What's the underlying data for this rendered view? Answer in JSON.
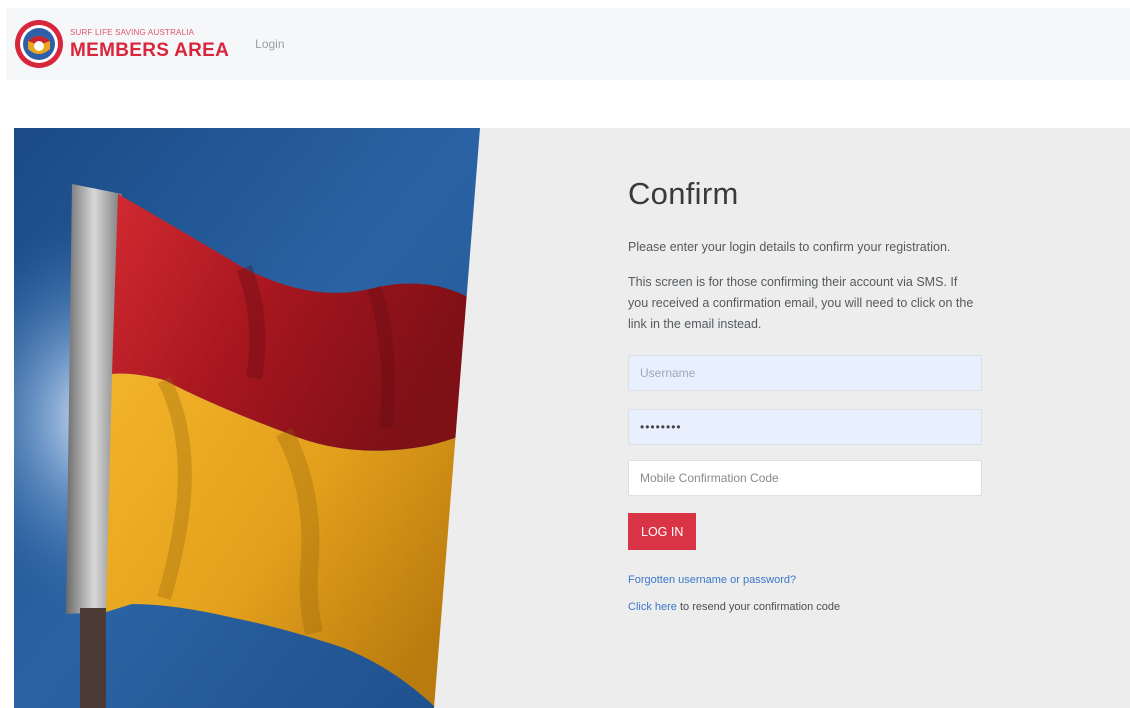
{
  "navbar": {
    "brand_small": "SURF LIFE SAVING AUSTRALIA",
    "brand_title": "MEMBERS AREA",
    "login_link": "Login",
    "logo_icon": "surf-life-saving-emblem-icon"
  },
  "hero": {
    "image": "red-and-yellow-lifesaving-flag",
    "colors": {
      "sky": "#1f4f88",
      "flag_red": "#b61f2b",
      "flag_yellow": "#e7a51a",
      "pole": "#8a8a8a"
    }
  },
  "form": {
    "title": "Confirm",
    "intro": "Please enter your login details to confirm your registration.",
    "note": "This screen is for those confirming their account via SMS. If you received a confirmation email, you will need to click on the link in the email instead.",
    "username_placeholder": "Username",
    "password_value": "••••••••",
    "code_placeholder": "Mobile Confirmation Code",
    "login_button": "LOG IN",
    "forgot_link": "Forgotten username or password?",
    "click_here_link": "Click here",
    "resend_text": " to resend your confirmation code"
  },
  "colors": {
    "brand_red": "#d8263c",
    "button_red": "#d93346",
    "link_blue": "#3b78c9",
    "autofill_blue": "#e9f0fd",
    "panel_grey": "#ededed"
  }
}
